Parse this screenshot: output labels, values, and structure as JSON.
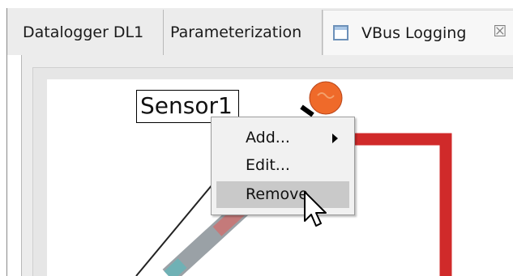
{
  "tabs": [
    {
      "label": "Datalogger DL1"
    },
    {
      "label": "Parameterization"
    },
    {
      "label": "VBus Logging",
      "icon": "window-icon",
      "close_icon": "close-icon"
    }
  ],
  "canvas": {
    "sensor_label": "Sensor1"
  },
  "context_menu": {
    "items": [
      {
        "label": "Add...",
        "has_submenu": true
      },
      {
        "label": "Edit..."
      },
      {
        "label": "Remove",
        "highlighted": true
      }
    ]
  },
  "colors": {
    "pipe_red": "#d02a2a",
    "sensor_orange": "#ef6a2a",
    "menu_highlight": "#c9c9c9"
  }
}
